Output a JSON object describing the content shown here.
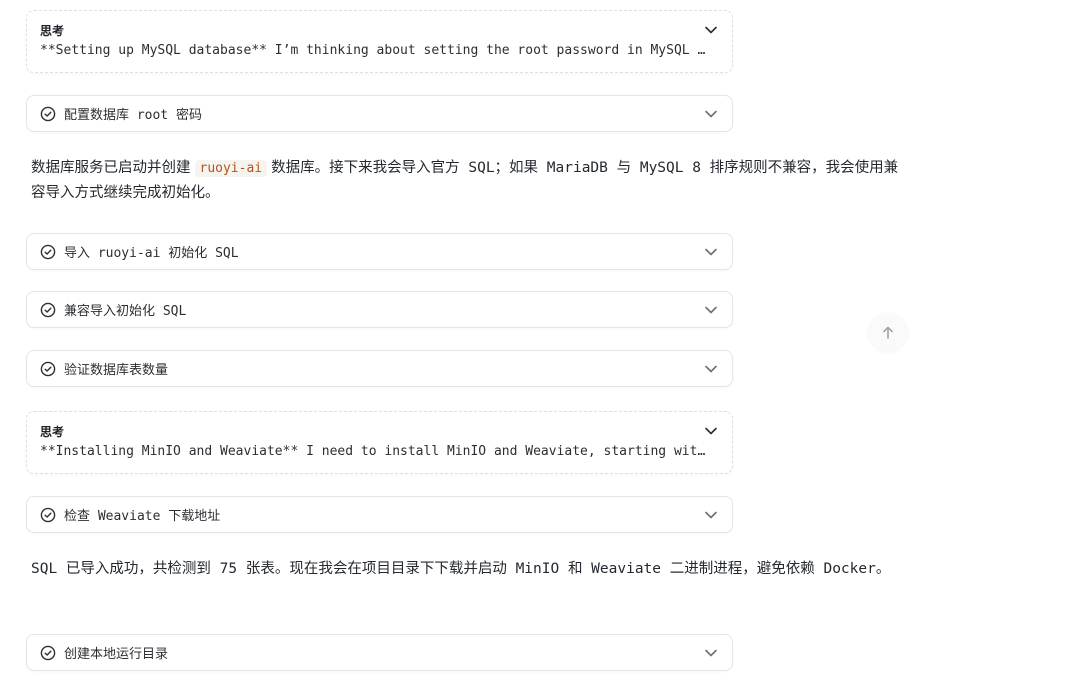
{
  "think_1": {
    "title": "思考",
    "body": "**Setting up MySQL database** I’m thinking about setting the root password in MySQL …"
  },
  "step_1": {
    "label": "配置数据库 root 密码"
  },
  "para_1": {
    "before": "数据库服务已启动并创建",
    "code": "ruoyi-ai",
    "after": "数据库。接下来我会导入官方 SQL；如果 MariaDB 与 MySQL 8 排序规则不兼容，我会使用兼容导入方式继续完成初始化。"
  },
  "step_2": {
    "label": "导入 ruoyi-ai 初始化 SQL"
  },
  "step_3": {
    "label": "兼容导入初始化 SQL"
  },
  "step_4": {
    "label": "验证数据库表数量"
  },
  "think_2": {
    "title": "思考",
    "body": "**Installing MinIO and Weaviate** I need to install MinIO and Weaviate, starting wit…"
  },
  "step_5": {
    "label": "检查 Weaviate 下载地址"
  },
  "para_2": {
    "text": "SQL 已导入成功，共检测到 75 张表。现在我会在项目目录下下载并启动 MinIO 和 Weaviate 二进制进程，避免依赖 Docker。"
  },
  "step_6": {
    "label": "创建本地运行目录"
  },
  "icons": {
    "check": "check-circle-icon",
    "chevron": "chevron-down-icon",
    "scroll_top": "arrow-up-icon"
  },
  "colors": {
    "code_text": "#b3541e",
    "code_bg": "#f6f4ef",
    "border": "#e3e5e8"
  }
}
